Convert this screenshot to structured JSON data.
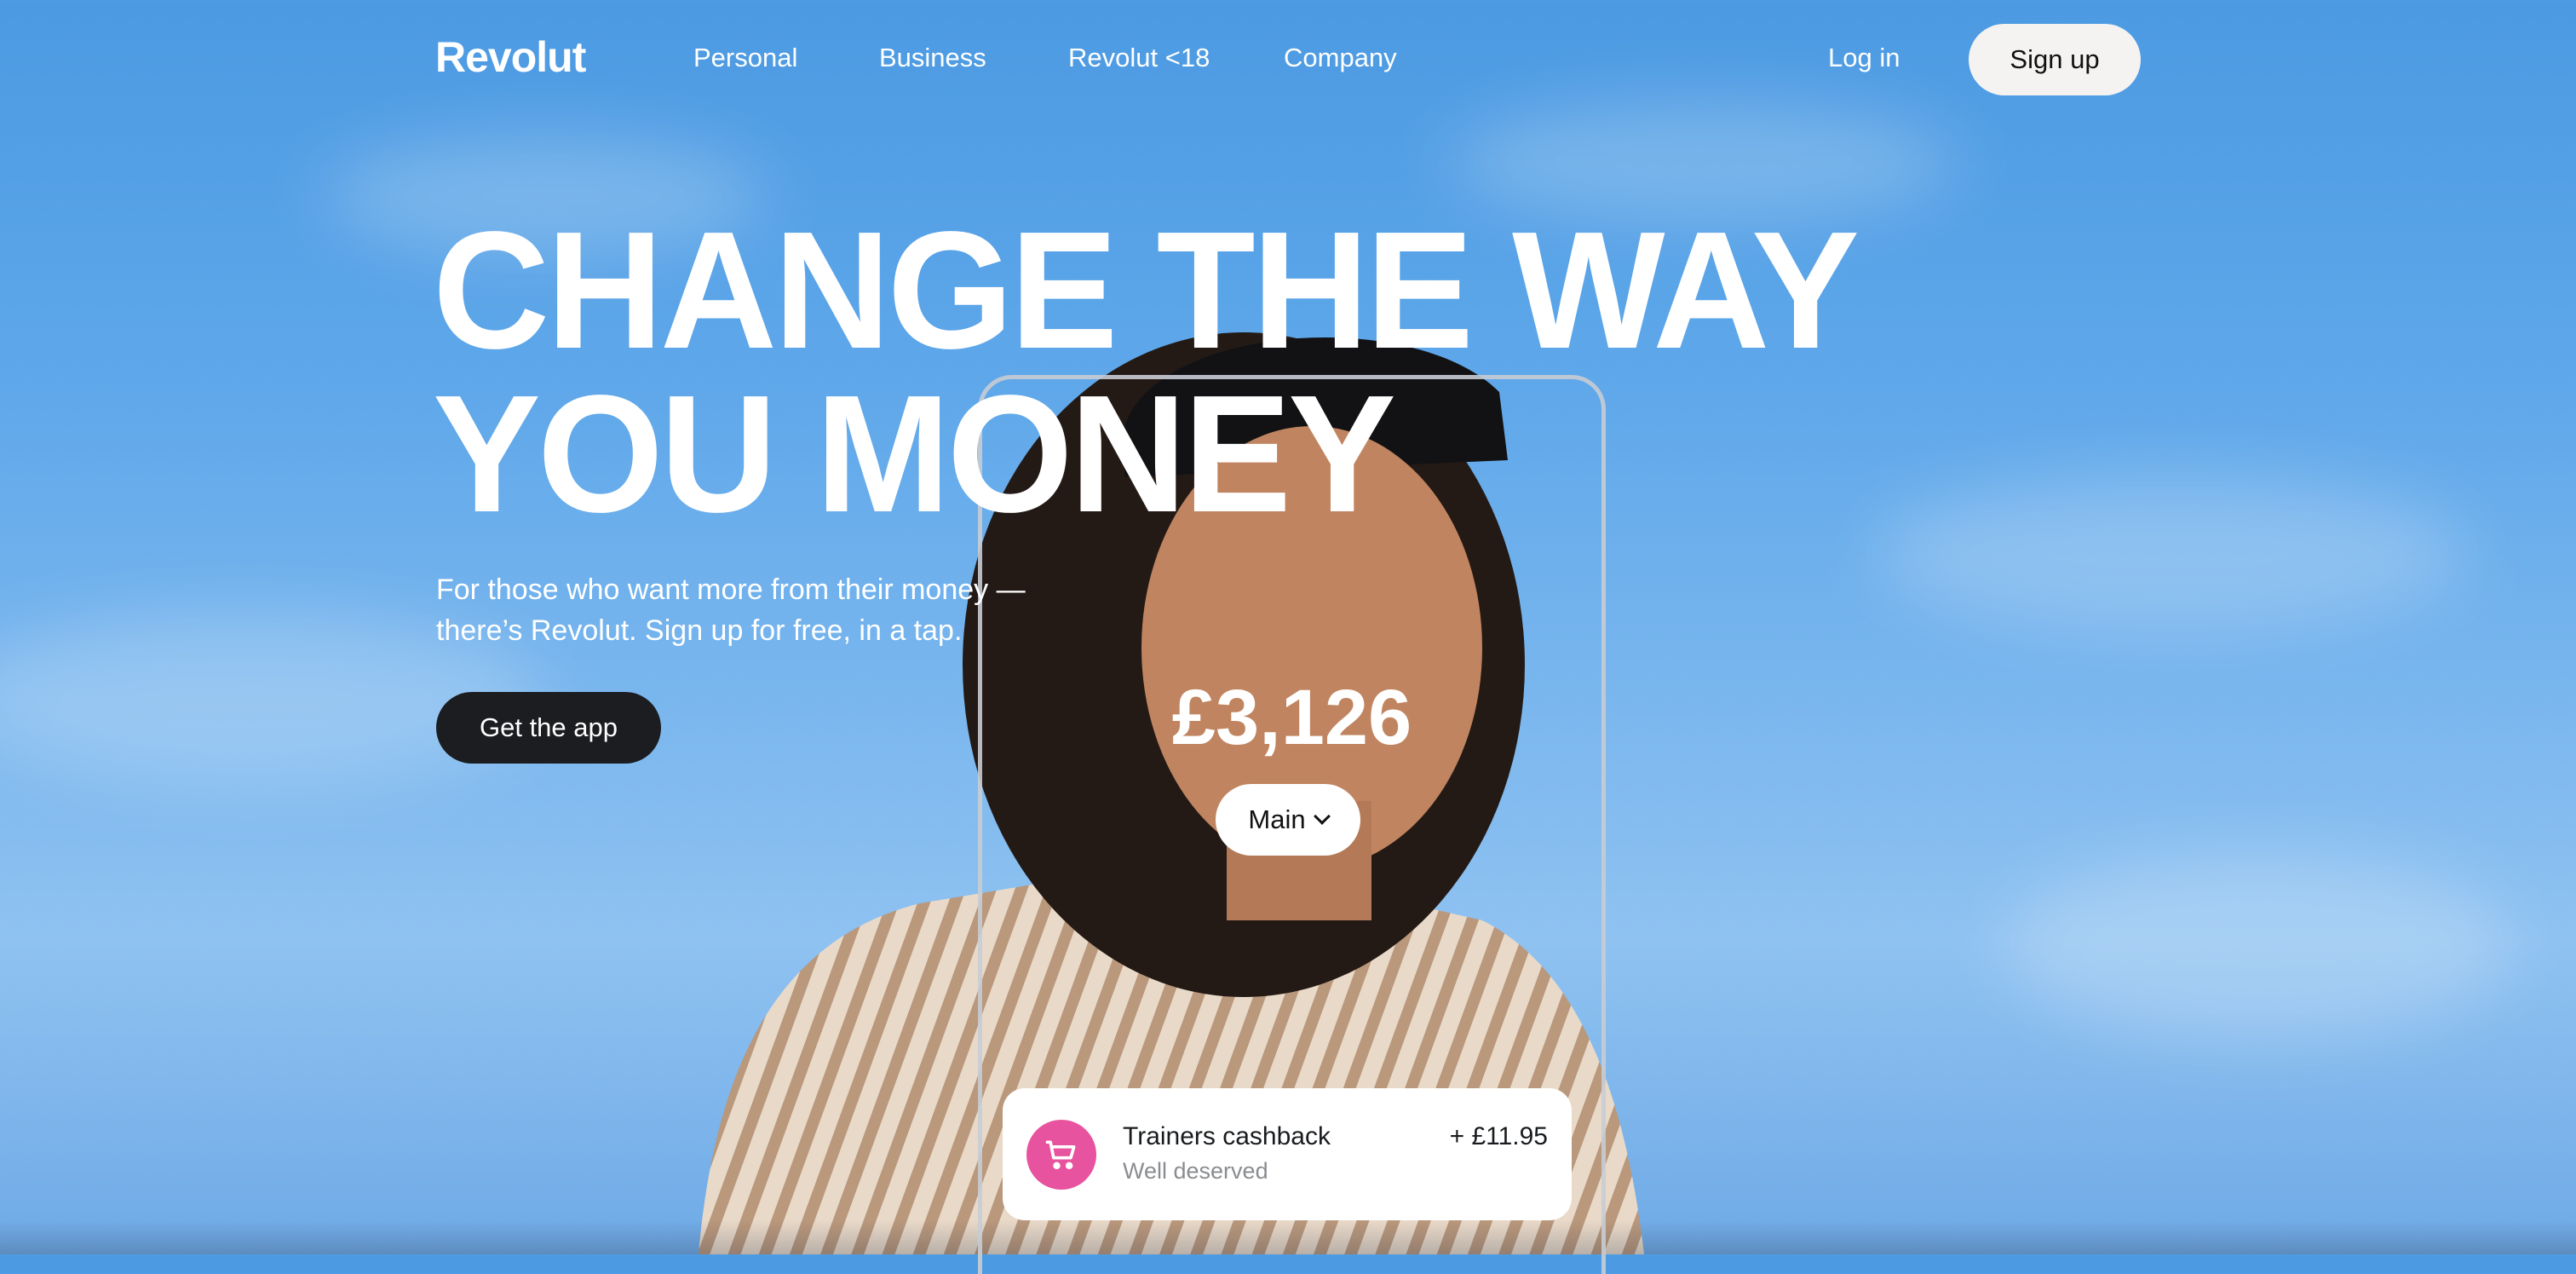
{
  "nav": {
    "logo": "Revolut",
    "links": [
      "Personal",
      "Business",
      "Revolut <18",
      "Company"
    ],
    "login": "Log in",
    "signup": "Sign up"
  },
  "hero": {
    "headline_line1": "CHANGE THE WAY",
    "headline_line2": "YOU MONEY",
    "subtitle_line1": "For those who want more from their money —",
    "subtitle_line2": "there’s Revolut. Sign up for free, in a tap.",
    "cta": "Get the app"
  },
  "phone": {
    "balance": "£3,126",
    "account": "Main",
    "transaction": {
      "icon": "shopping-cart-icon",
      "title": "Trainers cashback",
      "subtitle": "Well deserved",
      "amount": "+ £11.95",
      "icon_color": "#e8539f"
    }
  },
  "colors": {
    "sky": "#4c9ae2",
    "cta_dark": "#1c1d20",
    "signup_bg": "#f4f3f2"
  }
}
